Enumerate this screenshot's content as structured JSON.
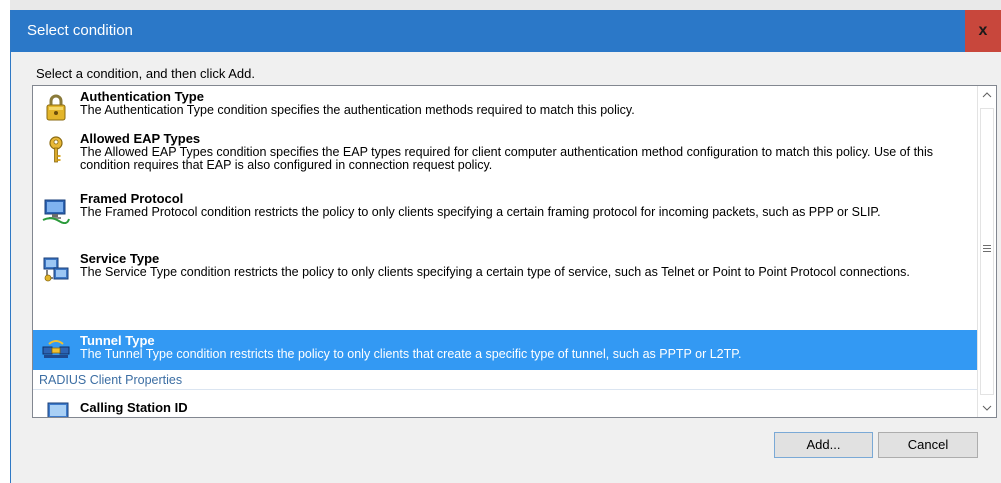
{
  "window": {
    "title": "Select condition",
    "close_label": "x"
  },
  "instruction": "Select a condition, and then click Add.",
  "items": [
    {
      "name": "Authentication Type",
      "description": "The Authentication Type condition specifies the authentication methods required to match this policy.",
      "icon": "padlock-icon",
      "selected": false
    },
    {
      "name": "Allowed EAP Types",
      "description": "The Allowed EAP Types condition specifies the EAP types required for client computer authentication method configuration to match this policy. Use of this condition requires that EAP is also configured in connection request policy.",
      "icon": "key-icon",
      "selected": false
    },
    {
      "name": "Framed Protocol",
      "description": "The Framed Protocol condition restricts the policy to only clients specifying a certain framing protocol for incoming packets, such as PPP or SLIP.",
      "icon": "network-computer-icon",
      "selected": false
    },
    {
      "name": "Service Type",
      "description": "The Service Type condition restricts the policy to only clients specifying a certain type of service, such as Telnet or Point to Point Protocol connections.",
      "icon": "service-network-icon",
      "selected": false
    },
    {
      "name": "Tunnel Type",
      "description": "The Tunnel Type condition restricts the policy to only clients that create a specific type of tunnel, such as PPTP or L2TP.",
      "icon": "tunnel-icon",
      "selected": true
    }
  ],
  "group_header": "RADIUS Client Properties",
  "partial_item": {
    "name": "Calling Station ID",
    "icon": "monitor-icon"
  },
  "buttons": {
    "add": "Add...",
    "cancel": "Cancel"
  },
  "colors": {
    "titlebar": "#2b78c8",
    "close": "#c8473c",
    "selection": "#3399f3",
    "group_header_text": "#3c6ea3"
  }
}
